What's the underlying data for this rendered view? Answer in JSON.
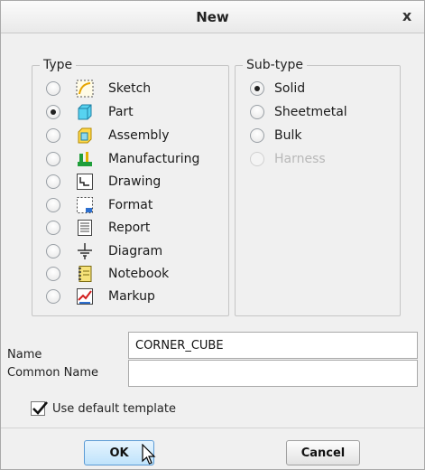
{
  "dialog": {
    "title": "New",
    "close_label": "x"
  },
  "type_group": {
    "legend": "Type",
    "options": [
      {
        "label": "Sketch",
        "icon": "sketch-icon",
        "checked": false
      },
      {
        "label": "Part",
        "icon": "part-icon",
        "checked": true
      },
      {
        "label": "Assembly",
        "icon": "assembly-icon",
        "checked": false
      },
      {
        "label": "Manufacturing",
        "icon": "manufacturing-icon",
        "checked": false
      },
      {
        "label": "Drawing",
        "icon": "drawing-icon",
        "checked": false
      },
      {
        "label": "Format",
        "icon": "format-icon",
        "checked": false
      },
      {
        "label": "Report",
        "icon": "report-icon",
        "checked": false
      },
      {
        "label": "Diagram",
        "icon": "diagram-icon",
        "checked": false
      },
      {
        "label": "Notebook",
        "icon": "notebook-icon",
        "checked": false
      },
      {
        "label": "Markup",
        "icon": "markup-icon",
        "checked": false
      }
    ]
  },
  "subtype_group": {
    "legend": "Sub-type",
    "options": [
      {
        "label": "Solid",
        "checked": true,
        "disabled": false
      },
      {
        "label": "Sheetmetal",
        "checked": false,
        "disabled": false
      },
      {
        "label": "Bulk",
        "checked": false,
        "disabled": false
      },
      {
        "label": "Harness",
        "checked": false,
        "disabled": true
      }
    ]
  },
  "fields": {
    "name_label": "Name",
    "name_value": "CORNER_CUBE",
    "common_name_label": "Common Name",
    "common_name_value": ""
  },
  "options": {
    "use_default_template_label": "Use default template",
    "use_default_template_checked": true
  },
  "buttons": {
    "ok_label": "OK",
    "cancel_label": "Cancel"
  },
  "colors": {
    "ok_button_border": "#5b9bd5",
    "ok_button_fill": "#bfe3fb",
    "dialog_background": "#f0f0f0"
  }
}
